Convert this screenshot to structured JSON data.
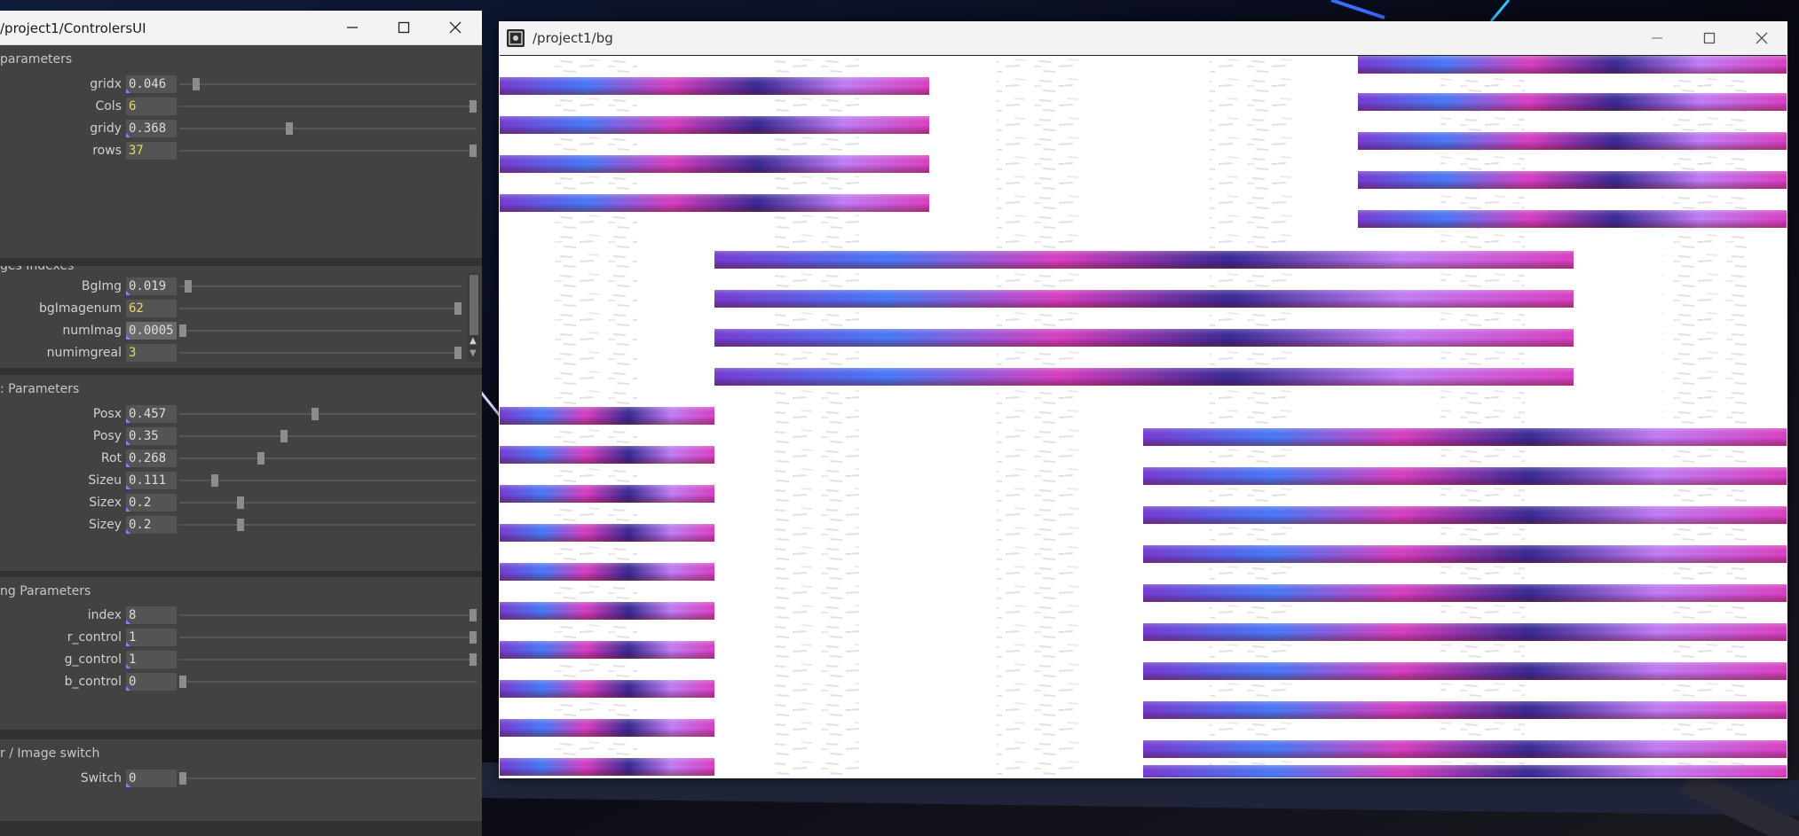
{
  "controllers_window": {
    "title": "/project1/ControlersUI",
    "icons": {
      "minimize": "minimize-icon",
      "maximize": "maximize-icon",
      "close": "close-icon"
    },
    "panels": [
      {
        "title": "parameters",
        "rows": [
          {
            "label": "gridx",
            "value": "0.046",
            "kind": "float",
            "slider": 0.046
          },
          {
            "label": "Cols",
            "value": "6",
            "kind": "int",
            "slider": 1.0
          },
          {
            "label": "gridy",
            "value": "0.368",
            "kind": "float",
            "slider": 0.368
          },
          {
            "label": "rows",
            "value": "37",
            "kind": "int",
            "slider": 1.0
          }
        ]
      },
      {
        "title": "ges Indexes",
        "rows": [
          {
            "label": "BgImg",
            "value": "0.019",
            "kind": "float",
            "slider": 0.019
          },
          {
            "label": "bgImagenum",
            "value": "62",
            "kind": "int",
            "slider": 1.0
          },
          {
            "label": "numImag",
            "value": "0.0005",
            "kind": "float",
            "slider": 0.0005
          },
          {
            "label": "numimgreal",
            "value": "3",
            "kind": "int",
            "slider": 1.0
          }
        ]
      },
      {
        "title": ": Parameters",
        "rows": [
          {
            "label": "Posx",
            "value": "0.457",
            "kind": "float",
            "slider": 0.457
          },
          {
            "label": "Posy",
            "value": "0.35",
            "kind": "float",
            "slider": 0.35
          },
          {
            "label": "Rot",
            "value": "0.268",
            "kind": "float",
            "slider": 0.268
          },
          {
            "label": "Sizeu",
            "value": "0.111",
            "kind": "float",
            "slider": 0.111
          },
          {
            "label": "Sizex",
            "value": "0.2",
            "kind": "float",
            "slider": 0.2
          },
          {
            "label": "Sizey",
            "value": "0.2",
            "kind": "float",
            "slider": 0.2
          }
        ]
      },
      {
        "title": "ng Parameters",
        "rows": [
          {
            "label": "index",
            "value": "8",
            "kind": "int-box",
            "slider": 1.0
          },
          {
            "label": "r_control",
            "value": "1",
            "kind": "float",
            "slider": 1.0
          },
          {
            "label": "g_control",
            "value": "1",
            "kind": "float",
            "slider": 1.0
          },
          {
            "label": "b_control",
            "value": "0",
            "kind": "float",
            "slider": 0.0
          }
        ]
      },
      {
        "title": "r / Image switch",
        "rows": [
          {
            "label": "Switch",
            "value": "0",
            "kind": "float",
            "slider": 0.0
          }
        ]
      }
    ]
  },
  "bg_window": {
    "title": "/project1/bg",
    "icons": {
      "app": "touchdesigner-app-icon",
      "minimize": "minimize-icon",
      "maximize": "maximize-icon",
      "close": "close-icon"
    }
  },
  "colors": {
    "panel_bg": "#424242",
    "value_float": "#dcdcdc",
    "value_int": "#e9d85a",
    "stripe_purple": "#7a3cd8",
    "stripe_pink": "#e040c8",
    "stripe_blue": "#4a7cff"
  }
}
